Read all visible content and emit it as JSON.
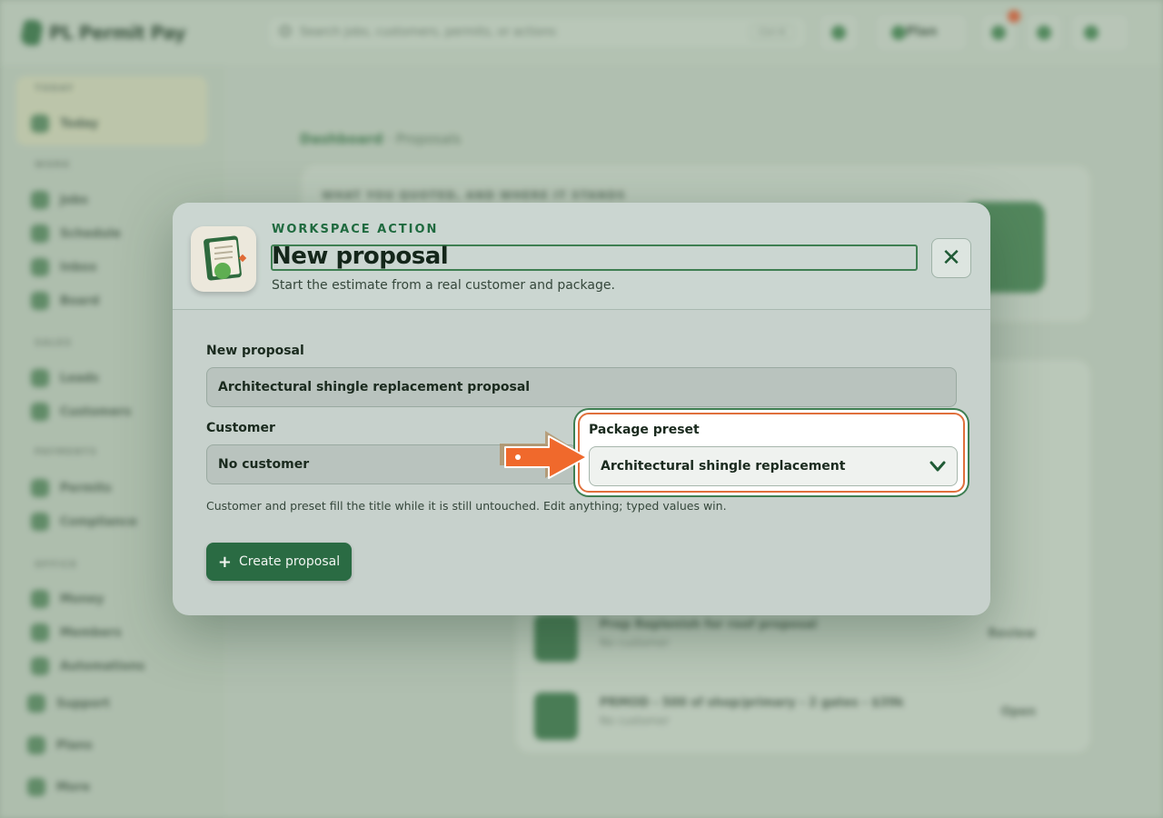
{
  "app": {
    "brand": "PL Permit Pay",
    "search_placeholder": "Search jobs, customers, permits, or actions",
    "search_shortcut": "Ctrl K",
    "plan_label": "Plan",
    "sidebar": {
      "groups": [
        {
          "heading": "TODAY",
          "items": [
            {
              "label": "Today"
            }
          ]
        },
        {
          "heading": "WORK",
          "items": [
            {
              "label": "Jobs"
            },
            {
              "label": "Schedule"
            },
            {
              "label": "Inbox"
            },
            {
              "label": "Board"
            }
          ]
        },
        {
          "heading": "SALES",
          "items": [
            {
              "label": "Leads"
            },
            {
              "label": "Customers"
            }
          ]
        },
        {
          "heading": "PAYMENTS",
          "items": [
            {
              "label": "Permits"
            },
            {
              "label": "Compliance"
            }
          ]
        },
        {
          "heading": "OFFICE",
          "items": [
            {
              "label": "Money"
            },
            {
              "label": "Members"
            },
            {
              "label": "Automations"
            }
          ]
        }
      ],
      "footer": [
        {
          "label": "Support"
        },
        {
          "label": "Plans"
        },
        {
          "label": "More"
        }
      ]
    },
    "breadcrumb": {
      "root": "Dashboard",
      "current": "Proposals"
    },
    "hero_caption": "WHAT YOU QUOTED, AND WHERE IT STANDS",
    "list_rows": [
      {
        "title": "Prep Replenish for roof proposal",
        "sub": "No customer",
        "status": "Review"
      },
      {
        "title": "PRMOD - 500 sf shop/primary - 2 gates - $39k",
        "sub": "No customer",
        "status": "Open"
      }
    ]
  },
  "modal": {
    "eyebrow": "WORKSPACE ACTION",
    "title": "New proposal",
    "subtitle": "Start the estimate from a real customer and package.",
    "close_icon": "close-icon",
    "fields": {
      "name": {
        "label": "New proposal",
        "value": "Architectural shingle replacement proposal"
      },
      "customer": {
        "label": "Customer",
        "value": "No customer"
      },
      "preset": {
        "label": "Package preset",
        "value": "Architectural shingle replacement"
      }
    },
    "helper": "Customer and preset fill the title while it is still untouched. Edit anything; typed values win.",
    "create_label": "Create proposal"
  },
  "colors": {
    "accent": "#2a6b43",
    "highlight": "#e0703c",
    "scrim": "#9fae9f"
  }
}
